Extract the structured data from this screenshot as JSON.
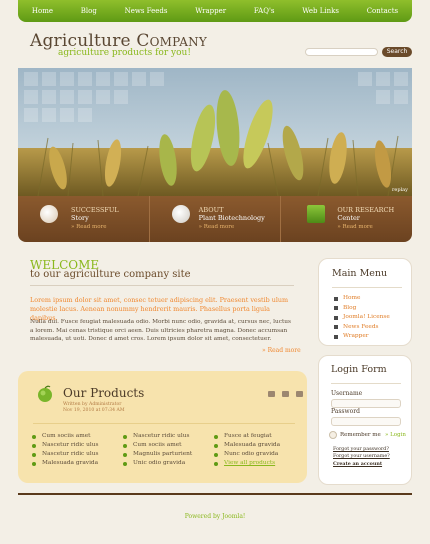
{
  "nav": {
    "items": [
      "Home",
      "Blog",
      "News Feeds",
      "Wrapper",
      "FAQ's",
      "Web Links",
      "Contacts"
    ]
  },
  "header": {
    "title_main": "Agriculture ",
    "title_caps": "Company",
    "tagline": "agriculture products for you!",
    "search_placeholder": "",
    "search_button": "Search"
  },
  "banner": {
    "caption": "replay"
  },
  "strip": [
    {
      "title": "SUCCESSFUL",
      "subtitle": "Story",
      "more": "» Read more"
    },
    {
      "title": "ABOUT",
      "subtitle": "Plant Biotechnology",
      "more": "» Read more"
    },
    {
      "title": "OUR RESEARCH",
      "subtitle": "Center",
      "more": "» Read more"
    }
  ],
  "welcome": {
    "heading": "WELCOME",
    "subheading": "to our agriculture company site",
    "lead": "Lorem ipsum dolor sit amet, consec tetuer adipiscing elit. Praesent vestib ulum molestie lacus. Aenean nonummy hendrerit mauris. Phasellus porta ligula dapibus.",
    "body": "Nulla dui. Fusce feugiat malesuada odio. Morbi nunc odio, gravida at, cursus nec, luctus a lorem. Mai cenas tristique orci aeen. Duis ultricies pharetra magna. Donec accumsan malesuada, ut uoti. Donec d amet cros. Lorem ipsum dolor sit amet, consectetuer.",
    "read_more": "» Read more"
  },
  "products": {
    "title": "Our Products",
    "meta_author": "Written by Administrator",
    "meta_date": "Nov 19, 2010 at 07:34 AM",
    "col1": [
      "Cum sociis amet",
      "Nascetur ridic ulus",
      "Nascetur ridic ulus",
      "Malesuada gravida"
    ],
    "col2": [
      "Nascetur ridic ulus",
      "Cum sociis amet",
      "Magnulis parturient",
      "Unic odio gravida"
    ],
    "col3": [
      "Fusce at feugiat",
      "Malesuada gravida",
      "Nunc odio gravida",
      "View all products"
    ]
  },
  "main_menu": {
    "title": "Main Menu",
    "items": [
      "Home",
      "Blog",
      "Joomla! License",
      "News Feeds",
      "Wrapper"
    ]
  },
  "login_form": {
    "title": "Login Form",
    "username_label": "Username",
    "password_label": "Password",
    "remember_label": "Remember me",
    "login_button": "» Login",
    "forgot_password": "Forgot your password?",
    "forgot_username": "Forgot your username?",
    "create_account": "Create an account"
  },
  "footer": {
    "text": "Powered by Joomla!"
  },
  "colors": {
    "accent_green": "#8ab81d",
    "brown": "#6b4220",
    "orange": "#f08830"
  }
}
